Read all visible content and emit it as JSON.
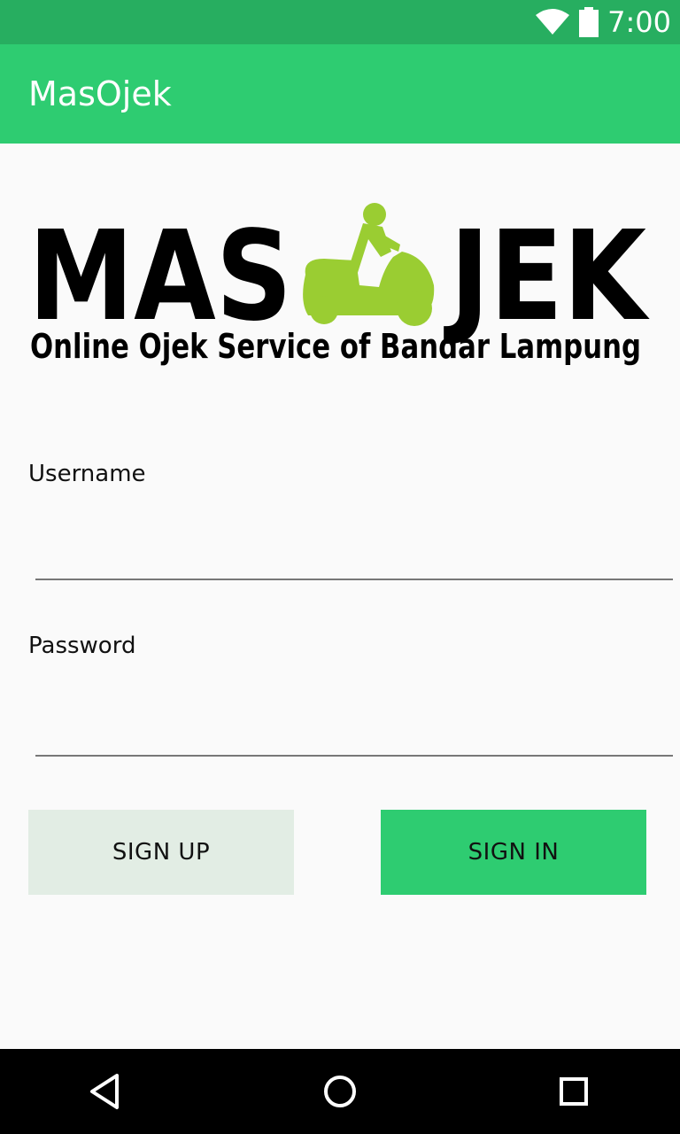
{
  "status_bar": {
    "time": "7:00",
    "icons": [
      "wifi-icon",
      "battery-icon"
    ],
    "background": "#27ae60"
  },
  "app_bar": {
    "title": "MasOjek",
    "background": "#2ecc71"
  },
  "logo": {
    "text_left": "MAS",
    "text_right": "JEK",
    "tagline": "Online Ojek Service of Bandar Lampung",
    "accent_color": "#9acd32"
  },
  "form": {
    "username": {
      "label": "Username",
      "value": "",
      "placeholder": ""
    },
    "password": {
      "label": "Password",
      "value": "",
      "placeholder": ""
    }
  },
  "buttons": {
    "sign_up": "SIGN UP",
    "sign_in": "SIGN IN"
  },
  "nav_bar": {
    "icons": [
      "back-icon",
      "home-icon",
      "recents-icon"
    ]
  }
}
